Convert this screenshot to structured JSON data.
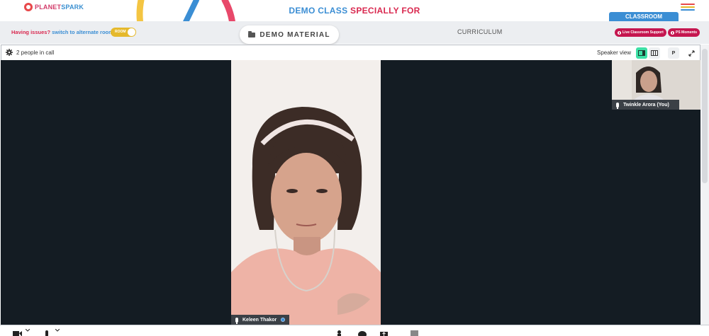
{
  "header": {
    "logo_text_1": "PLANET",
    "logo_text_2": "SPARK",
    "title_part1": "DEMO CLASS ",
    "title_part2": "SPECIALLY FOR"
  },
  "subbar": {
    "issues_text": "Having issues?",
    "switch_text": "switch to alternate room",
    "toggle_label": "ROOM",
    "demo_material_label": "DEMO MATERIAL",
    "curriculum_label": "CURRICULUM",
    "classroom_tab_label": "CLASSROOM",
    "live_support_label": "Live Classroom Support",
    "ps_moments_label": "PS Moments"
  },
  "call": {
    "people_count_text": "2 people in call",
    "view_label": "Speaker view",
    "p_button_label": "P"
  },
  "participants": {
    "main": {
      "name": "Keleen Thakor"
    },
    "self": {
      "name": "Twinkle Arora (You)"
    }
  },
  "colors": {
    "brand_blue": "#3b8ed4",
    "brand_red": "#d9284f",
    "support_pink": "#c5164f",
    "speaker_active": "#3ee0a6",
    "stage_bg": "#141c23"
  },
  "icons": [
    "planetspark-logo-icon",
    "menu-icon",
    "folder-icon",
    "gear-icon",
    "speaker-view-icon",
    "grid-view-icon",
    "fullscreen-icon",
    "mic-icon",
    "camera-icon",
    "person-icon",
    "chat-icon",
    "share-icon",
    "stop-icon"
  ]
}
